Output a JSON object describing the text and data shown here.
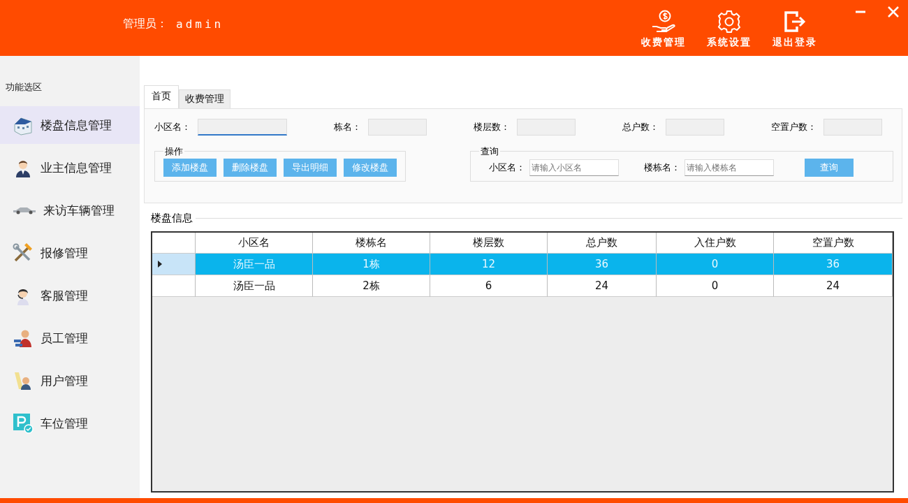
{
  "header": {
    "admin_label": "管理员：",
    "admin_name": "admin",
    "actions": [
      {
        "label": "收费管理"
      },
      {
        "label": "系统设置"
      },
      {
        "label": "退出登录"
      }
    ]
  },
  "sidebar": {
    "title": "功能选区",
    "items": [
      {
        "label": "楼盘信息管理",
        "selected": true
      },
      {
        "label": "业主信息管理",
        "selected": false
      },
      {
        "label": "来访车辆管理",
        "selected": false
      },
      {
        "label": "报修管理",
        "selected": false
      },
      {
        "label": "客服管理",
        "selected": false
      },
      {
        "label": "员工管理",
        "selected": false
      },
      {
        "label": "用户管理",
        "selected": false
      },
      {
        "label": "车位管理",
        "selected": false
      }
    ]
  },
  "tabs": [
    {
      "label": "首页",
      "selected": true
    },
    {
      "label": "收费管理",
      "selected": false
    }
  ],
  "fields": [
    {
      "label": "小区名：",
      "focused": true
    },
    {
      "label": "栋名：",
      "focused": false
    },
    {
      "label": "楼层数：",
      "focused": false
    },
    {
      "label": "总户数：",
      "focused": false
    },
    {
      "label": "空置户数：",
      "focused": false
    }
  ],
  "operations": {
    "title": "操作",
    "buttons": [
      "添加楼盘",
      "删除楼盘",
      "导出明细",
      "修改楼盘"
    ]
  },
  "query": {
    "title": "查询",
    "fields": [
      {
        "label": "小区名：",
        "placeholder": "请输入小区名"
      },
      {
        "label": "楼栋名：",
        "placeholder": "请输入楼栋名"
      }
    ],
    "button": "查询"
  },
  "table": {
    "title": "楼盘信息",
    "columns": [
      "小区名",
      "楼栋名",
      "楼层数",
      "总户数",
      "入住户数",
      "空置户数"
    ],
    "rows": [
      {
        "selected": true,
        "cells": [
          "汤臣一品",
          "1栋",
          "12",
          "36",
          "0",
          "36"
        ]
      },
      {
        "selected": false,
        "cells": [
          "汤臣一品",
          "2栋",
          "6",
          "24",
          "0",
          "24"
        ]
      }
    ]
  }
}
